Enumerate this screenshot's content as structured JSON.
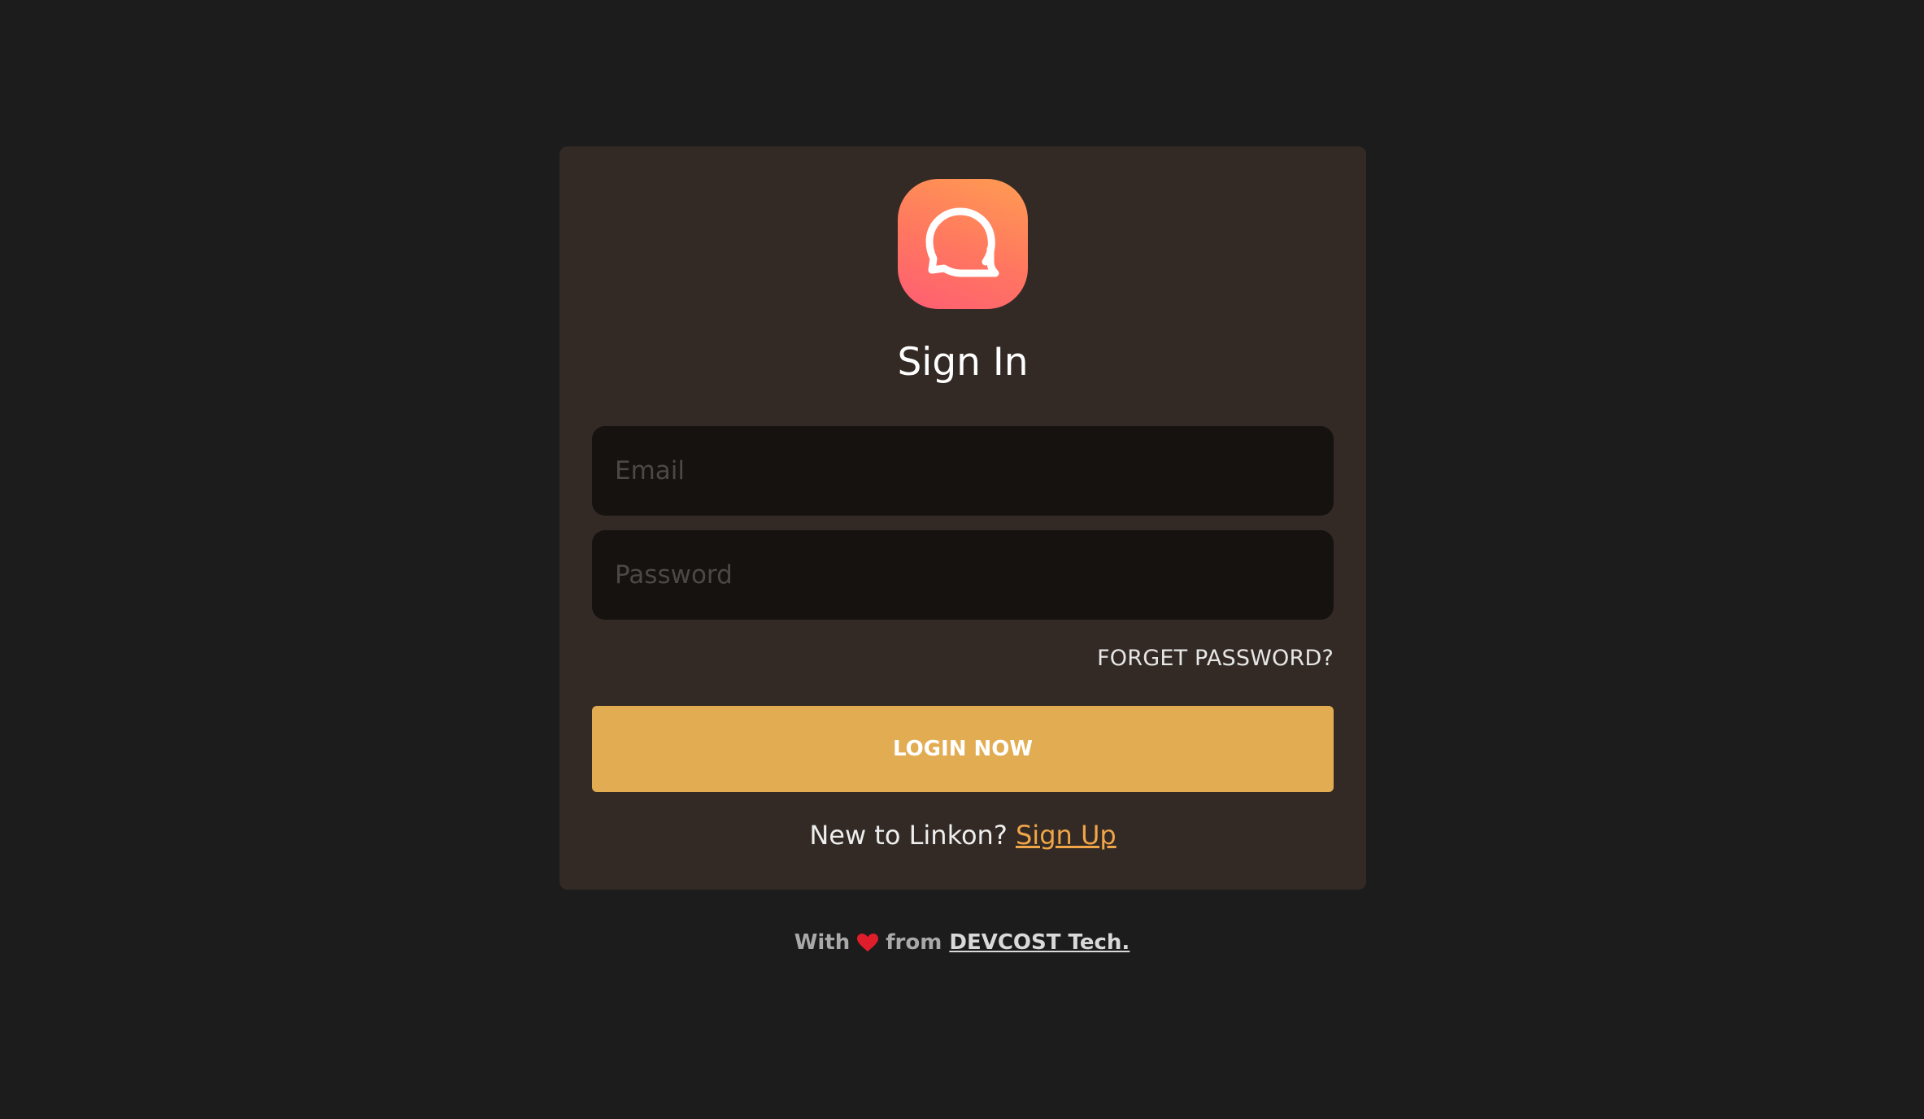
{
  "app": {
    "logo_icon": "chat-bubbles-icon",
    "title": "Sign In"
  },
  "form": {
    "email_placeholder": "Email",
    "password_placeholder": "Password",
    "email_value": "",
    "password_value": "",
    "forget_password_label": "FORGET PASSWORD?",
    "login_button_label": "LOGIN NOW"
  },
  "signup": {
    "prompt": "New to Linkon?",
    "link_label": "Sign Up"
  },
  "footer": {
    "prefix": "With",
    "heart_icon": "heart-icon",
    "middle": "from",
    "link_label": "DEVCOST Tech."
  },
  "colors": {
    "background": "#1c1c1c",
    "card": "#332a25",
    "input": "#15120f",
    "accent": "#e2ac52",
    "link": "#f0a548",
    "logo_gradient_start": "#ff9c52",
    "logo_gradient_end": "#ff5e73",
    "heart": "#e01e2b"
  }
}
